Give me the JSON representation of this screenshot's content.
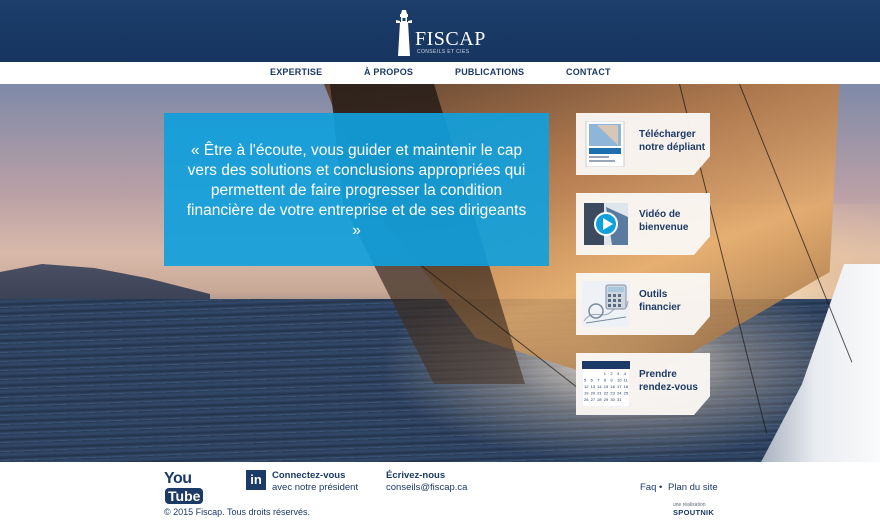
{
  "brand": {
    "name": "FISCAP",
    "tagline": "CONSEILS ET CIES",
    "primary_color": "#1b3a66",
    "accent_color": "#10a0dc"
  },
  "nav": {
    "items": [
      {
        "label": "EXPERTISE"
      },
      {
        "label": "À PROPOS"
      },
      {
        "label": "PUBLICATIONS"
      },
      {
        "label": "CONTACT"
      }
    ]
  },
  "hero": {
    "quote": "« Être à l'écoute, vous guider et maintenir le cap vers des solutions et conclusions appropriées qui permettent de faire progresser la condition financière de votre entreprise et de ses dirigeants »"
  },
  "cards": [
    {
      "line1": "Télécharger",
      "line2": "notre dépliant",
      "icon": "brochure-thumbnail"
    },
    {
      "line1": "Vidéo de",
      "line2": "bienvenue",
      "icon": "play-video-icon"
    },
    {
      "line1": "Outils",
      "line2": "financier",
      "icon": "calculator-icon"
    },
    {
      "line1": "Prendre",
      "line2": "rendez-vous",
      "icon": "calendar-icon"
    }
  ],
  "calendar_days": [
    "1",
    "2",
    "3",
    "4",
    "5",
    "6",
    "7",
    "8",
    "9",
    "10",
    "11",
    "12",
    "13",
    "14",
    "15",
    "16",
    "17",
    "18",
    "19",
    "20",
    "21",
    "22",
    "23",
    "24",
    "25",
    "26",
    "27",
    "28",
    "29",
    "30",
    "31"
  ],
  "footer": {
    "youtube_you": "You",
    "youtube_tube": "Tube",
    "linkedin_glyph": "in",
    "linkedin_title": "Connectez-vous",
    "linkedin_sub": "avec notre président",
    "email_title": "Écrivez-nous",
    "email": "conseils@fiscap.ca",
    "faq": "Faq",
    "separator": "•",
    "sitemap": "Plan du site",
    "copyright": "© 2015 Fiscap. Tous droits réservés.",
    "credit_prefix": "une réalisation",
    "credit_name": "SPOUTNIK"
  }
}
